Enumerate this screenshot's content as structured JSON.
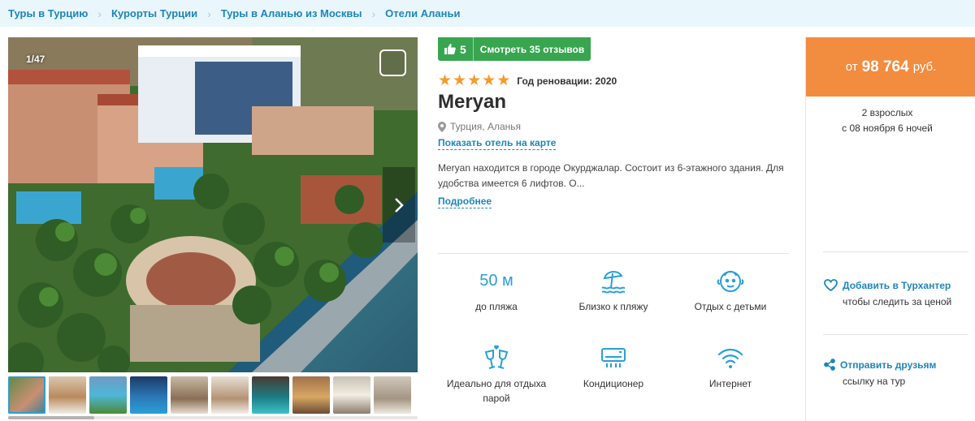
{
  "breadcrumbs": [
    "Туры в Турцию",
    "Курорты Турции",
    "Туры в Аланью из Москвы",
    "Отели Аланьи"
  ],
  "gallery": {
    "counter": "1/47",
    "thumbnail_count": 10
  },
  "rating": {
    "score": "5",
    "reviews_label": "Смотреть 35 отзывов"
  },
  "hotel": {
    "stars": 5,
    "renovation": "Год реновации: 2020",
    "name": "Meryan",
    "location": "Турция, Аланья",
    "map_link": "Показать отель на карте",
    "description": "Meryan находится в городе Окурджалар. Состоит из 6-этажного здания. Для удобства имеется 6 лифтов. О...",
    "more_link": "Подробнее"
  },
  "features": [
    {
      "icon": "distance",
      "value": "50 м",
      "label": "до пляжа"
    },
    {
      "icon": "beach-icon",
      "label": "Близко к пляжу"
    },
    {
      "icon": "baby-icon",
      "label": "Отдых с детьми"
    },
    {
      "icon": "champagne-icon",
      "label": "Идеально для отдыха парой"
    },
    {
      "icon": "air-conditioner-icon",
      "label": "Кондиционер"
    },
    {
      "icon": "wifi-icon",
      "label": "Интернет"
    }
  ],
  "price": {
    "prefix": "от",
    "value": "98 764",
    "currency": "руб."
  },
  "trip": {
    "guests": "2 взрослых",
    "dates": "с 08 ноября 6 ночей"
  },
  "actions": {
    "turhunter_label": "Добавить в Турхантер",
    "turhunter_sub": "чтобы следить за ценой",
    "share_label": "Отправить друзьям",
    "share_sub": "ссылку на тур"
  },
  "colors": {
    "accent": "#1d86b8",
    "price_bg": "#f28c3f",
    "rating_bg": "#38a54f",
    "star": "#f79a2d",
    "feature_icon": "#2a9fd8"
  }
}
